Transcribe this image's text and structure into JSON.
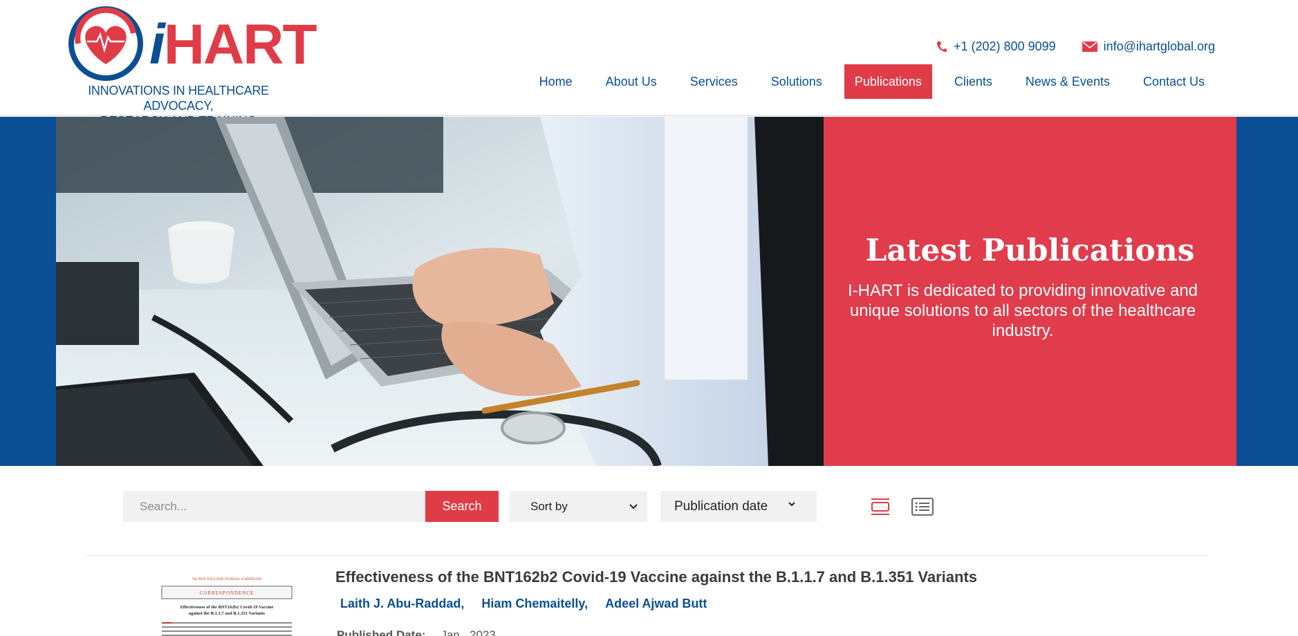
{
  "brand": {
    "name_i": "i",
    "name_rest": "HART",
    "tagline_line1": "INNOVATIONS IN HEALTHCARE ADVOCACY,",
    "tagline_line2": "RESEARCH AND TRAINING",
    "colors": {
      "red": "#e03c48",
      "blue": "#0a4f93"
    }
  },
  "contact": {
    "phone": "+1 (202) 800 9099",
    "email": "info@ihartglobal.org",
    "phone_icon": "phone-icon",
    "email_icon": "envelope-icon"
  },
  "nav": {
    "items": [
      {
        "label": "Home",
        "active": false
      },
      {
        "label": "About Us",
        "active": false
      },
      {
        "label": "Services",
        "active": false
      },
      {
        "label": "Solutions",
        "active": false
      },
      {
        "label": "Publications",
        "active": true
      },
      {
        "label": "Clients",
        "active": false
      },
      {
        "label": "News & Events",
        "active": false
      },
      {
        "label": "Contact Us",
        "active": false
      }
    ]
  },
  "hero": {
    "title": "Latest Publications",
    "text": "I-HART is dedicated to providing innovative and unique solutions to all sectors of the healthcare industry.",
    "image": "laptop-stethoscope-photo"
  },
  "toolbar": {
    "search_placeholder": "Search...",
    "search_button": "Search",
    "sort_label": "Sort by",
    "sort_value": "Publication date",
    "view_grid_icon": "grid-view-icon",
    "view_list_icon": "list-view-icon"
  },
  "publication": {
    "title": "Effectiveness of the BNT162b2 Covid-19 Vaccine against the B.1.1.7 and B.1.351 Variants",
    "authors": [
      "Laith J. Abu-Raddad,",
      "Hiam Chemaitelly,",
      "Adeel Ajwad Butt"
    ],
    "date_label": "Published Date:",
    "date_value": "Jan , 2023",
    "thumb": {
      "journal": "The NEW ENGLAND JOURNAL of MEDICINE",
      "section": "CORRESPONDENCE",
      "heading_line1": "Effectiveness of the BNT162b2 Covid-19 Vaccine",
      "heading_line2": "against the B.1.1.7 and B.1.351 Variants"
    }
  }
}
